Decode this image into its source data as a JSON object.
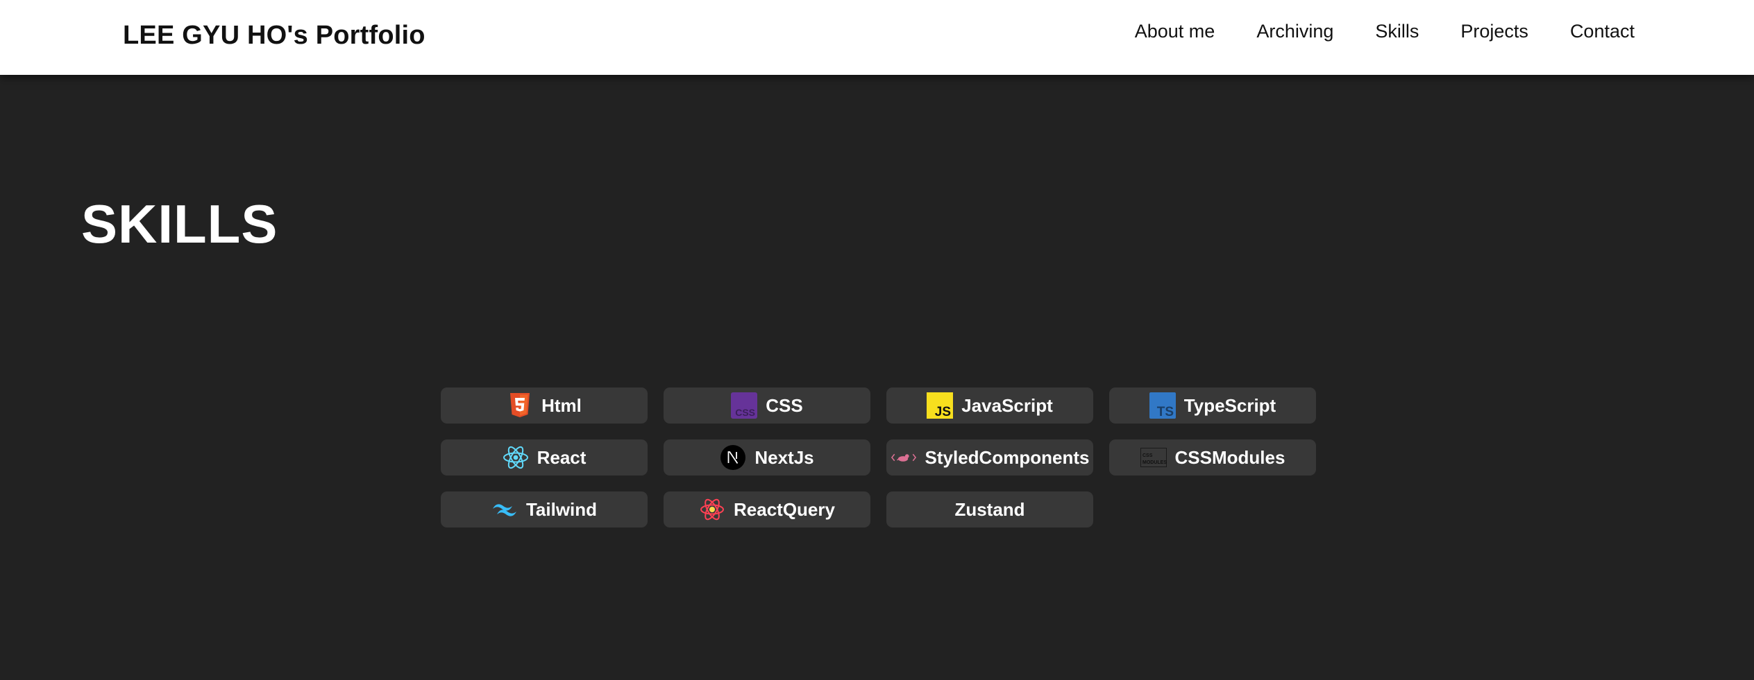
{
  "header": {
    "title": "LEE GYU HO's Portfolio",
    "nav": [
      {
        "label": "About me"
      },
      {
        "label": "Archiving"
      },
      {
        "label": "Skills"
      },
      {
        "label": "Projects"
      },
      {
        "label": "Contact"
      }
    ]
  },
  "skills_section": {
    "title": "SKILLS",
    "items": [
      {
        "label": "Html",
        "icon": "html5-icon",
        "color": "#E44D26"
      },
      {
        "label": "CSS",
        "icon": "css-icon",
        "color": "#663399"
      },
      {
        "label": "JavaScript",
        "icon": "javascript-icon",
        "color": "#F7DF1E"
      },
      {
        "label": "TypeScript",
        "icon": "typescript-icon",
        "color": "#3178C6"
      },
      {
        "label": "React",
        "icon": "react-icon",
        "color": "#61DAFB"
      },
      {
        "label": "NextJs",
        "icon": "nextjs-icon",
        "color": "#000000"
      },
      {
        "label": "StyledComponents",
        "icon": "styled-components-icon",
        "color": "#DB7093"
      },
      {
        "label": "CSSModules",
        "icon": "css-modules-icon",
        "color": "#000000"
      },
      {
        "label": "Tailwind",
        "icon": "tailwind-icon",
        "color": "#38BDF8"
      },
      {
        "label": "ReactQuery",
        "icon": "react-query-icon",
        "color": "#FF4154"
      },
      {
        "label": "Zustand",
        "icon": "",
        "color": ""
      }
    ]
  },
  "colors": {
    "background": "#222222",
    "header_background": "#ffffff",
    "skill_chip": "#383838"
  }
}
